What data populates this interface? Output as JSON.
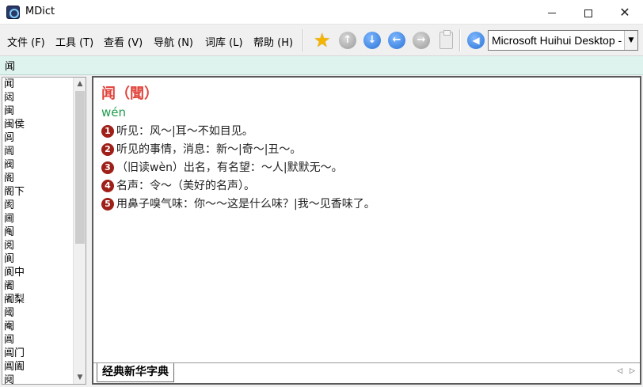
{
  "window": {
    "title": "MDict",
    "minimize": "—",
    "close": "✕"
  },
  "menu": [
    "文件 (F)",
    "工具 (T)",
    "查看 (V)",
    "导航 (N)",
    "词库 (L)",
    "帮助 (H)"
  ],
  "toolbar": {
    "voice_selected": "Microsoft Huihui Desktop - Chinese (Simplified)",
    "icons": [
      "star-icon",
      "up-icon",
      "down-icon",
      "back-icon",
      "forward-icon",
      "clipboard-icon",
      "speaker-icon"
    ]
  },
  "search": {
    "value": "闻"
  },
  "wordlist": [
    "闻",
    "闼",
    "闽",
    "闽侯",
    "闾",
    "闿",
    "阀",
    "阁",
    "阁下",
    "阂",
    "阃",
    "阄",
    "阅",
    "阆",
    "阆中",
    "阇",
    "阇梨",
    "阈",
    "阉",
    "阊",
    "阊门",
    "阊阖",
    "阋"
  ],
  "entry": {
    "headword": "闻（聞）",
    "pinyin": "wén",
    "senses": [
      {
        "num": "1",
        "text": "听见：风～|耳～不如目见。"
      },
      {
        "num": "2",
        "text": "听见的事情，消息：新～|奇～|丑～。"
      },
      {
        "num": "3",
        "text": "（旧读wèn）出名，有名望：～人|默默无～。"
      },
      {
        "num": "4",
        "text": "名声：令～（美好的名声）。"
      },
      {
        "num": "5",
        "text": "用鼻子嗅气味：你～～这是什么味？|我～见香味了。"
      }
    ]
  },
  "dictionary_tab": "经典新华字典",
  "colors": {
    "headword": "#e0433b",
    "pinyin": "#1e9c4c",
    "sense_number": "#9e2018",
    "search_bg": "#dff3ee"
  }
}
